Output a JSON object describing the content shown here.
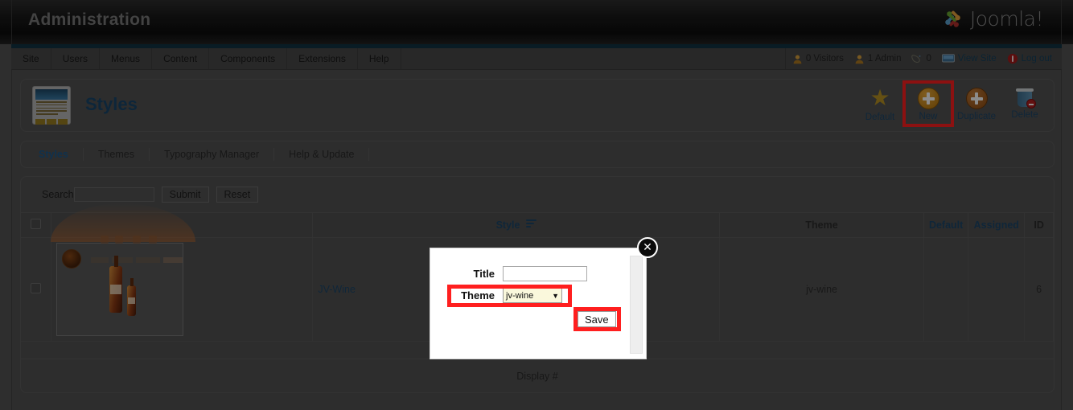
{
  "header": {
    "admin_title": "Administration",
    "brand": "Joomla!",
    "brand_icon": "joomla-logo-icon"
  },
  "menubar": {
    "items": [
      {
        "label": "Site"
      },
      {
        "label": "Users"
      },
      {
        "label": "Menus"
      },
      {
        "label": "Content"
      },
      {
        "label": "Components"
      },
      {
        "label": "Extensions"
      },
      {
        "label": "Help"
      }
    ],
    "status": [
      {
        "icon": "visitors-icon",
        "label": "0 Visitors"
      },
      {
        "icon": "admin-user-icon",
        "label": "1 Admin"
      },
      {
        "icon": "messages-icon",
        "label": "0"
      },
      {
        "icon": "view-site-icon",
        "label": "View Site"
      },
      {
        "icon": "logout-icon",
        "label": "Log out"
      }
    ]
  },
  "page": {
    "title": "Styles",
    "title_icon": "template-styles-icon"
  },
  "toolbar": {
    "buttons": [
      {
        "label": "Default",
        "icon": "star-icon",
        "highlighted": false
      },
      {
        "label": "New",
        "icon": "plus-circle-icon",
        "highlighted": true
      },
      {
        "label": "Duplicate",
        "icon": "plus-circle-icon",
        "highlighted": false
      },
      {
        "label": "Delete",
        "icon": "trash-icon",
        "highlighted": false
      }
    ]
  },
  "tabs": [
    {
      "label": "Styles",
      "active": true
    },
    {
      "label": "Themes",
      "active": false
    },
    {
      "label": "Typography Manager",
      "active": false
    },
    {
      "label": "Help & Update",
      "active": false
    }
  ],
  "search": {
    "label": "Search",
    "value": "",
    "placeholder": "",
    "submit_label": "Submit",
    "reset_label": "Reset"
  },
  "table": {
    "columns": {
      "check": "",
      "thumbnail": "",
      "style": "Style",
      "theme": "Theme",
      "default": "Default",
      "assigned": "Assigned",
      "id": "ID"
    },
    "rows": [
      {
        "style": "JV-Wine",
        "theme": "jv-wine",
        "default": "",
        "assigned": "",
        "id": "6",
        "thumbnail_alt": "jv-wine-template-preview"
      }
    ],
    "footer": "Display #"
  },
  "modal": {
    "close_label": "✕",
    "title_label": "Title",
    "title_value": "",
    "title_placeholder": "",
    "theme_label": "Theme",
    "theme_value": "jv-wine",
    "theme_caret": "▼",
    "save_label": "Save"
  },
  "colors": {
    "highlight_red": "#ff1f1f",
    "link_blue": "#1d4668",
    "page_bg": "#535353",
    "header_dark": "#141414",
    "teal_strip": "#123344",
    "select_bg": "#faf8dc"
  }
}
